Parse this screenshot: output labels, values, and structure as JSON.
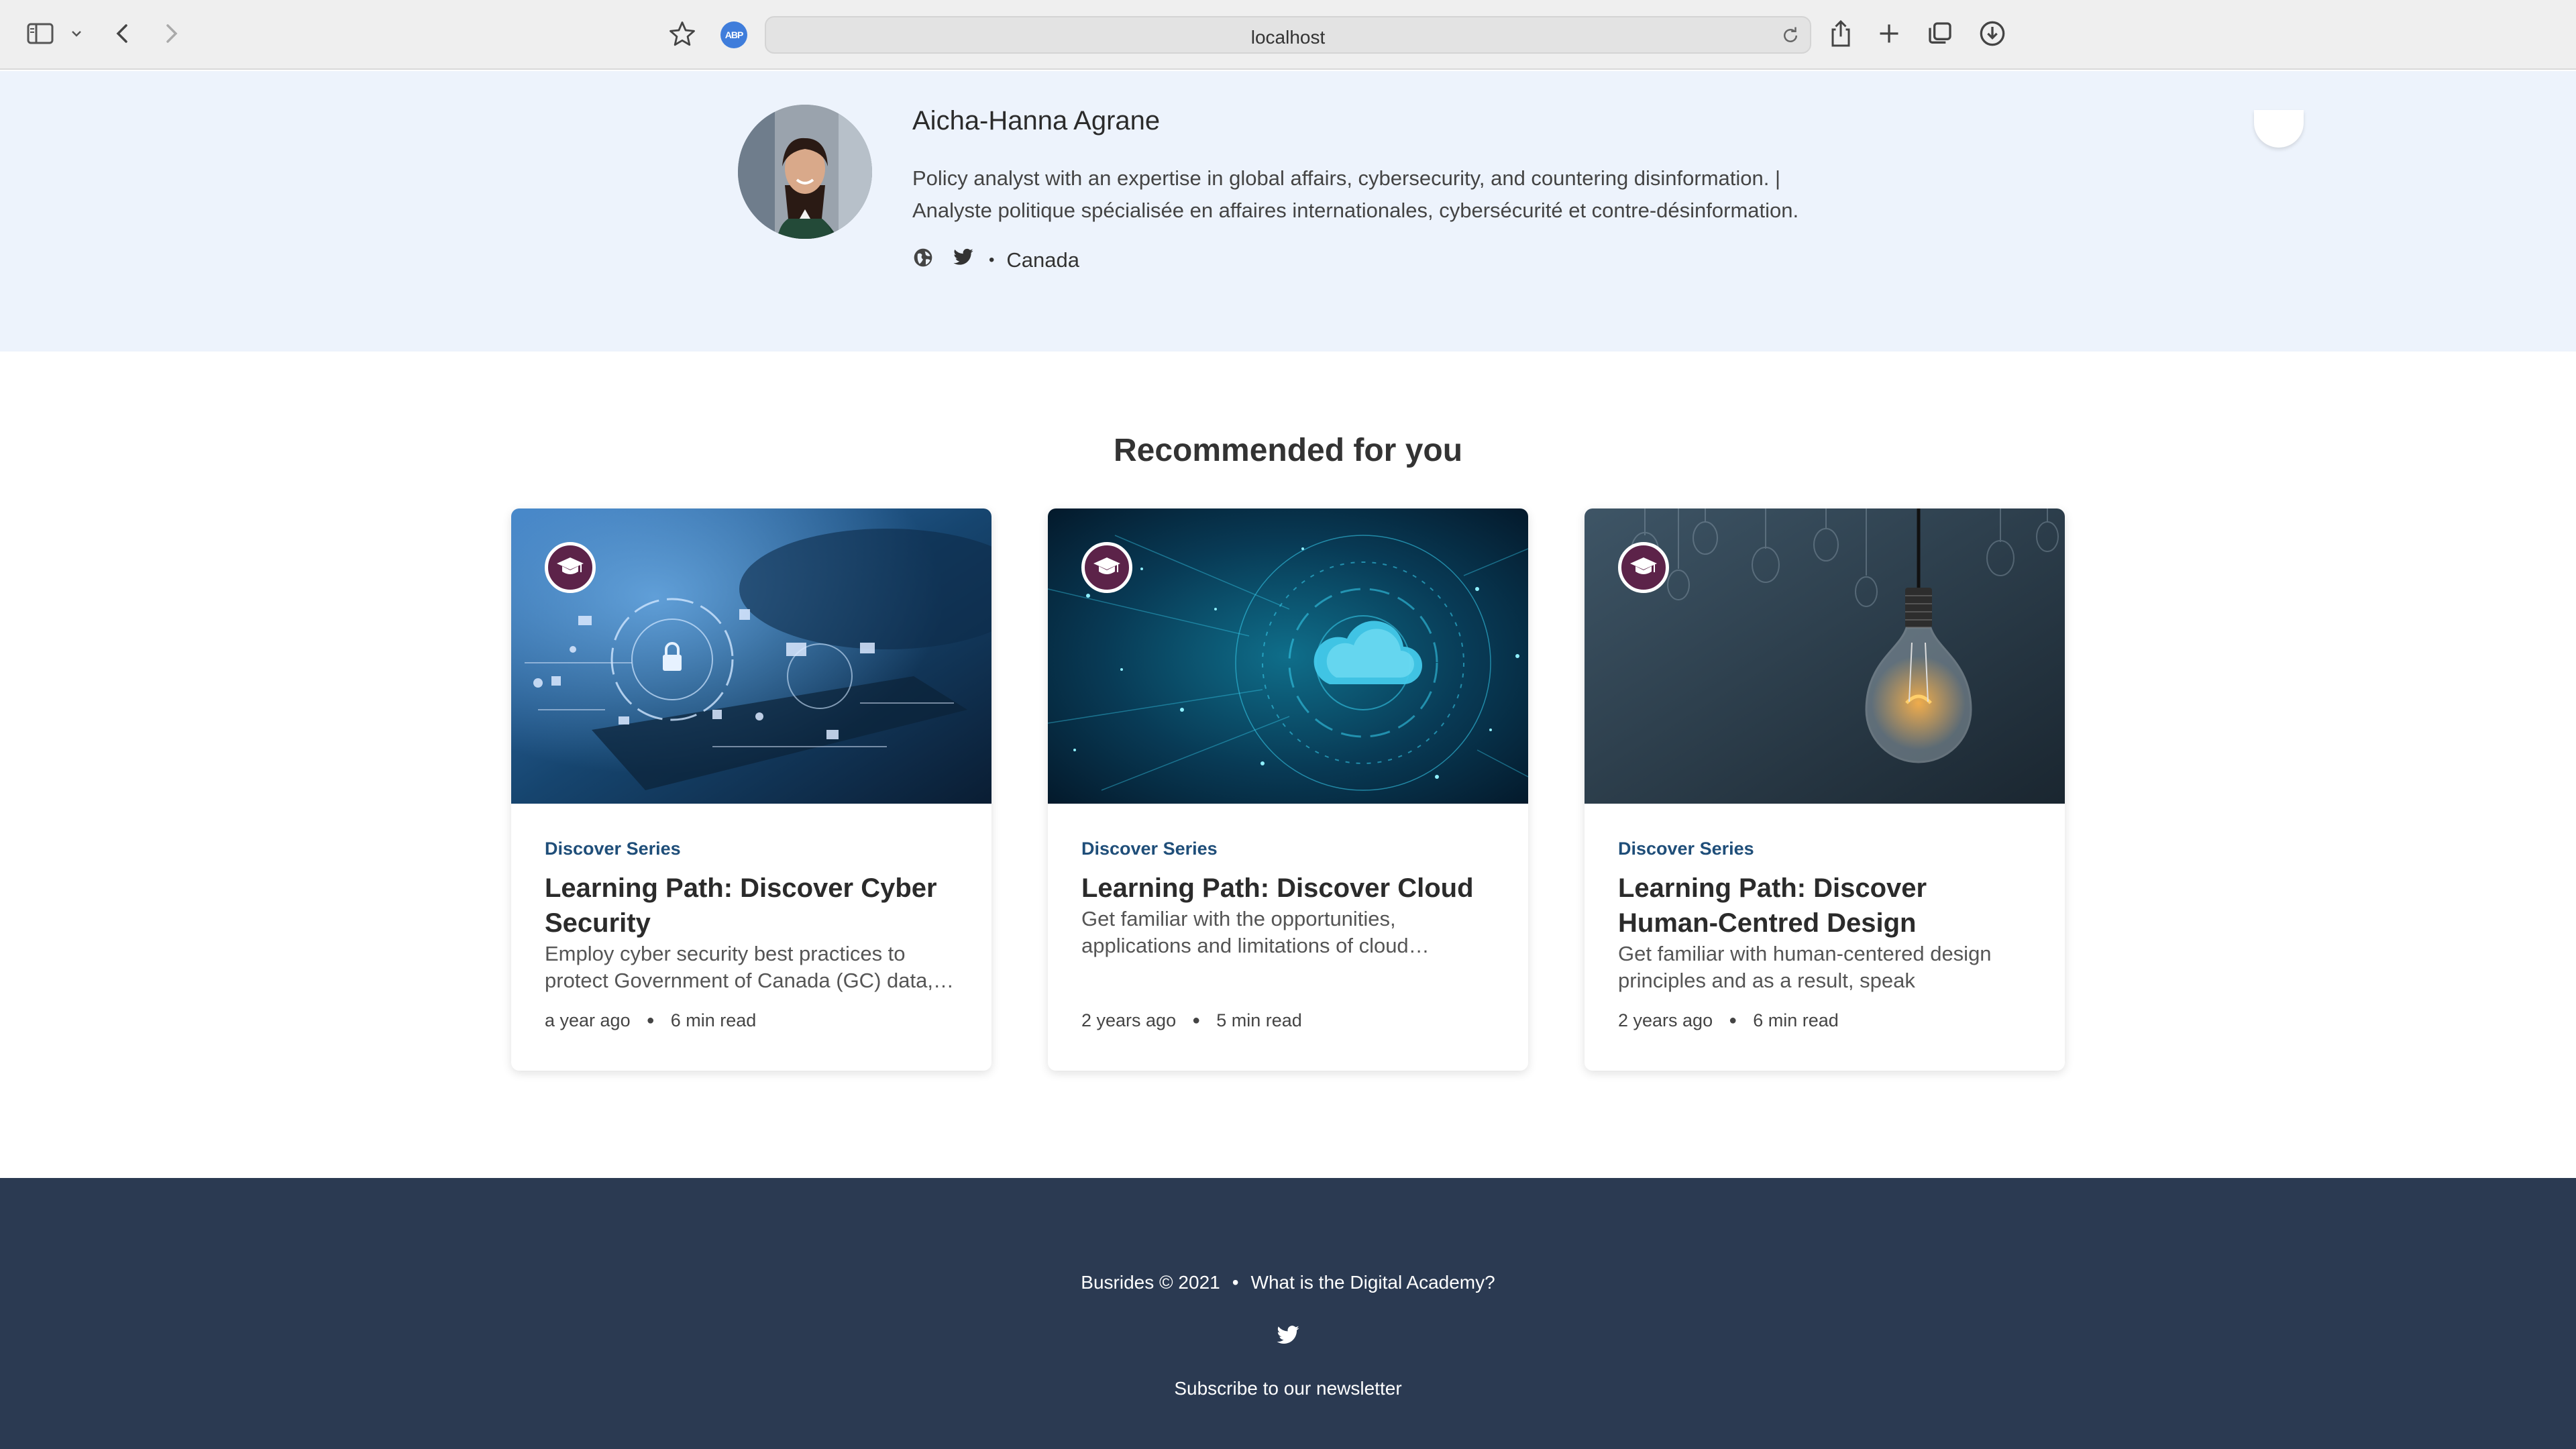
{
  "browser": {
    "url": "localhost",
    "abp_label": "ABP",
    "icons": [
      "sidebar-icon",
      "chevron-down-icon",
      "back-icon",
      "forward-icon",
      "star-icon",
      "reload-icon",
      "share-icon",
      "plus-icon",
      "tabs-icon",
      "download-icon"
    ]
  },
  "profile": {
    "name": "Aicha-Hanna Agrane",
    "bio_line1": "Policy analyst with an expertise in global affairs, cybersecurity, and countering disinformation. |",
    "bio_line2": "Analyste politique spécialisée en affaires internationales, cybersécurité et contre-désinformation.",
    "location": "Canada",
    "separator": "•"
  },
  "recommended": {
    "title": "Recommended for you",
    "cards": [
      {
        "series": "Discover Series",
        "title": "Learning Path: Discover Cyber Security",
        "description": "Employ cyber security best practices to protect Government of Canada (GC) data,…",
        "age": "a year ago",
        "read_time": "6 min read"
      },
      {
        "series": "Discover Series",
        "title": "Learning Path: Discover Cloud",
        "description": "Get familiar with the opportunities, applications and limitations of cloud…",
        "age": "2 years ago",
        "read_time": "5 min read"
      },
      {
        "series": "Discover Series",
        "title": "Learning Path: Discover Human-Centred Design",
        "description": "Get familiar with human-centered design principles and as a result, speak confidently…",
        "age": "2 years ago",
        "read_time": "6 min read"
      }
    ]
  },
  "footer": {
    "copyright": "Busrides © 2021",
    "separator": "•",
    "about_link": "What is the Digital Academy?",
    "newsletter": "Subscribe to our newsletter"
  },
  "colors": {
    "profile_bg": "#edf3fc",
    "badge": "#5c2349",
    "series_link": "#1f4e79",
    "footer_bg": "#2b3a52"
  }
}
